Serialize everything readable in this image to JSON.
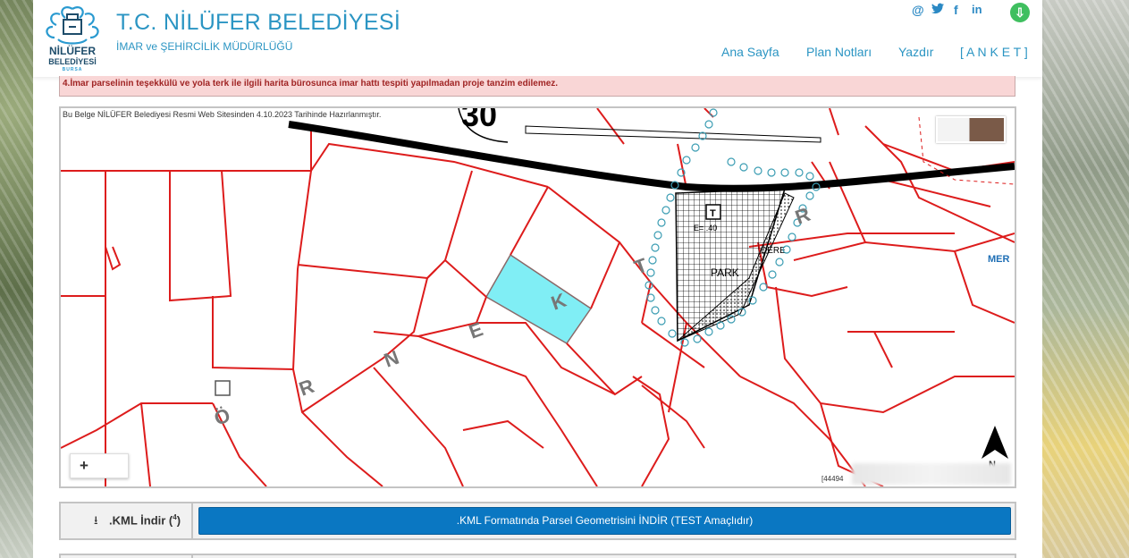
{
  "header": {
    "title": "T.C. NİLÜFER BELEDİYESİ",
    "subtitle": "İMAR ve ŞEHİRCİLİK MÜDÜRLÜĞÜ",
    "logo_line1": "NİLÜFER",
    "logo_line2": "BELEDİYESİ",
    "logo_line3": "BURSA",
    "social": [
      "@",
      "t",
      "f",
      "in"
    ],
    "download_icon": "download-icon",
    "nav": [
      "Ana Sayfa",
      "Plan Notları",
      "Yazdır",
      "[ A N K E T ]"
    ],
    "accent_color": "#2b95c3"
  },
  "warning": {
    "text": "4.İmar parselinin teşekkülü ve yola terk ile ilgili harita bürosunca imar hattı tespiti yapılmadan proje tanzim edilemez."
  },
  "map": {
    "note": "Bu Belge NİLÜFER Belediyesi Resmi Web Sitesinden 4.10.2023 Tarihinde Hazırlanmıştır.",
    "zoom_in": "+",
    "coord_prefix": "[44494",
    "labels": {
      "road_number": "30",
      "park": "PARK",
      "dere": "DERE",
      "mer": "MER",
      "ea": "E= .40",
      "t_marker": "T",
      "north": "N",
      "letters": [
        "Ö",
        "R",
        "N",
        "E",
        "K",
        "T",
        "R"
      ]
    }
  },
  "kml": {
    "label_icon": "download-icon",
    "label": ".KML İndir",
    "label_sup": "4",
    "button": ".KML Formatında Parsel Geometrisini İNDİR (TEST Amaçlıdır)"
  }
}
